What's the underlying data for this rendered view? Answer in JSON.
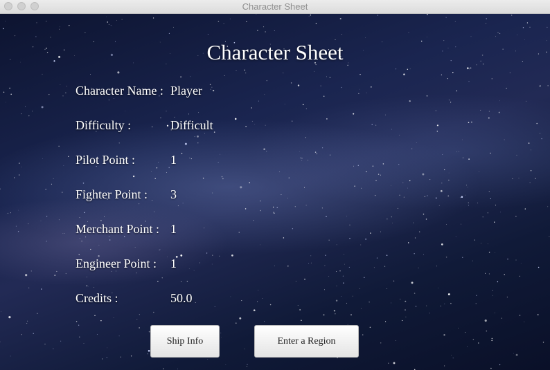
{
  "window": {
    "title": "Character Sheet"
  },
  "sheet": {
    "heading": "Character Sheet",
    "rows": [
      {
        "label": "Character Name :",
        "value": "Player"
      },
      {
        "label": "Difficulty :",
        "value": "Difficult"
      },
      {
        "label": "Pilot Point :",
        "value": "1"
      },
      {
        "label": "Fighter Point :",
        "value": "3"
      },
      {
        "label": "Merchant Point :",
        "value": "1"
      },
      {
        "label": "Engineer Point :",
        "value": "1"
      },
      {
        "label": "Credits :",
        "value": "50.0"
      }
    ]
  },
  "buttons": {
    "ship_info": "Ship Info",
    "enter_region": "Enter a Region"
  }
}
